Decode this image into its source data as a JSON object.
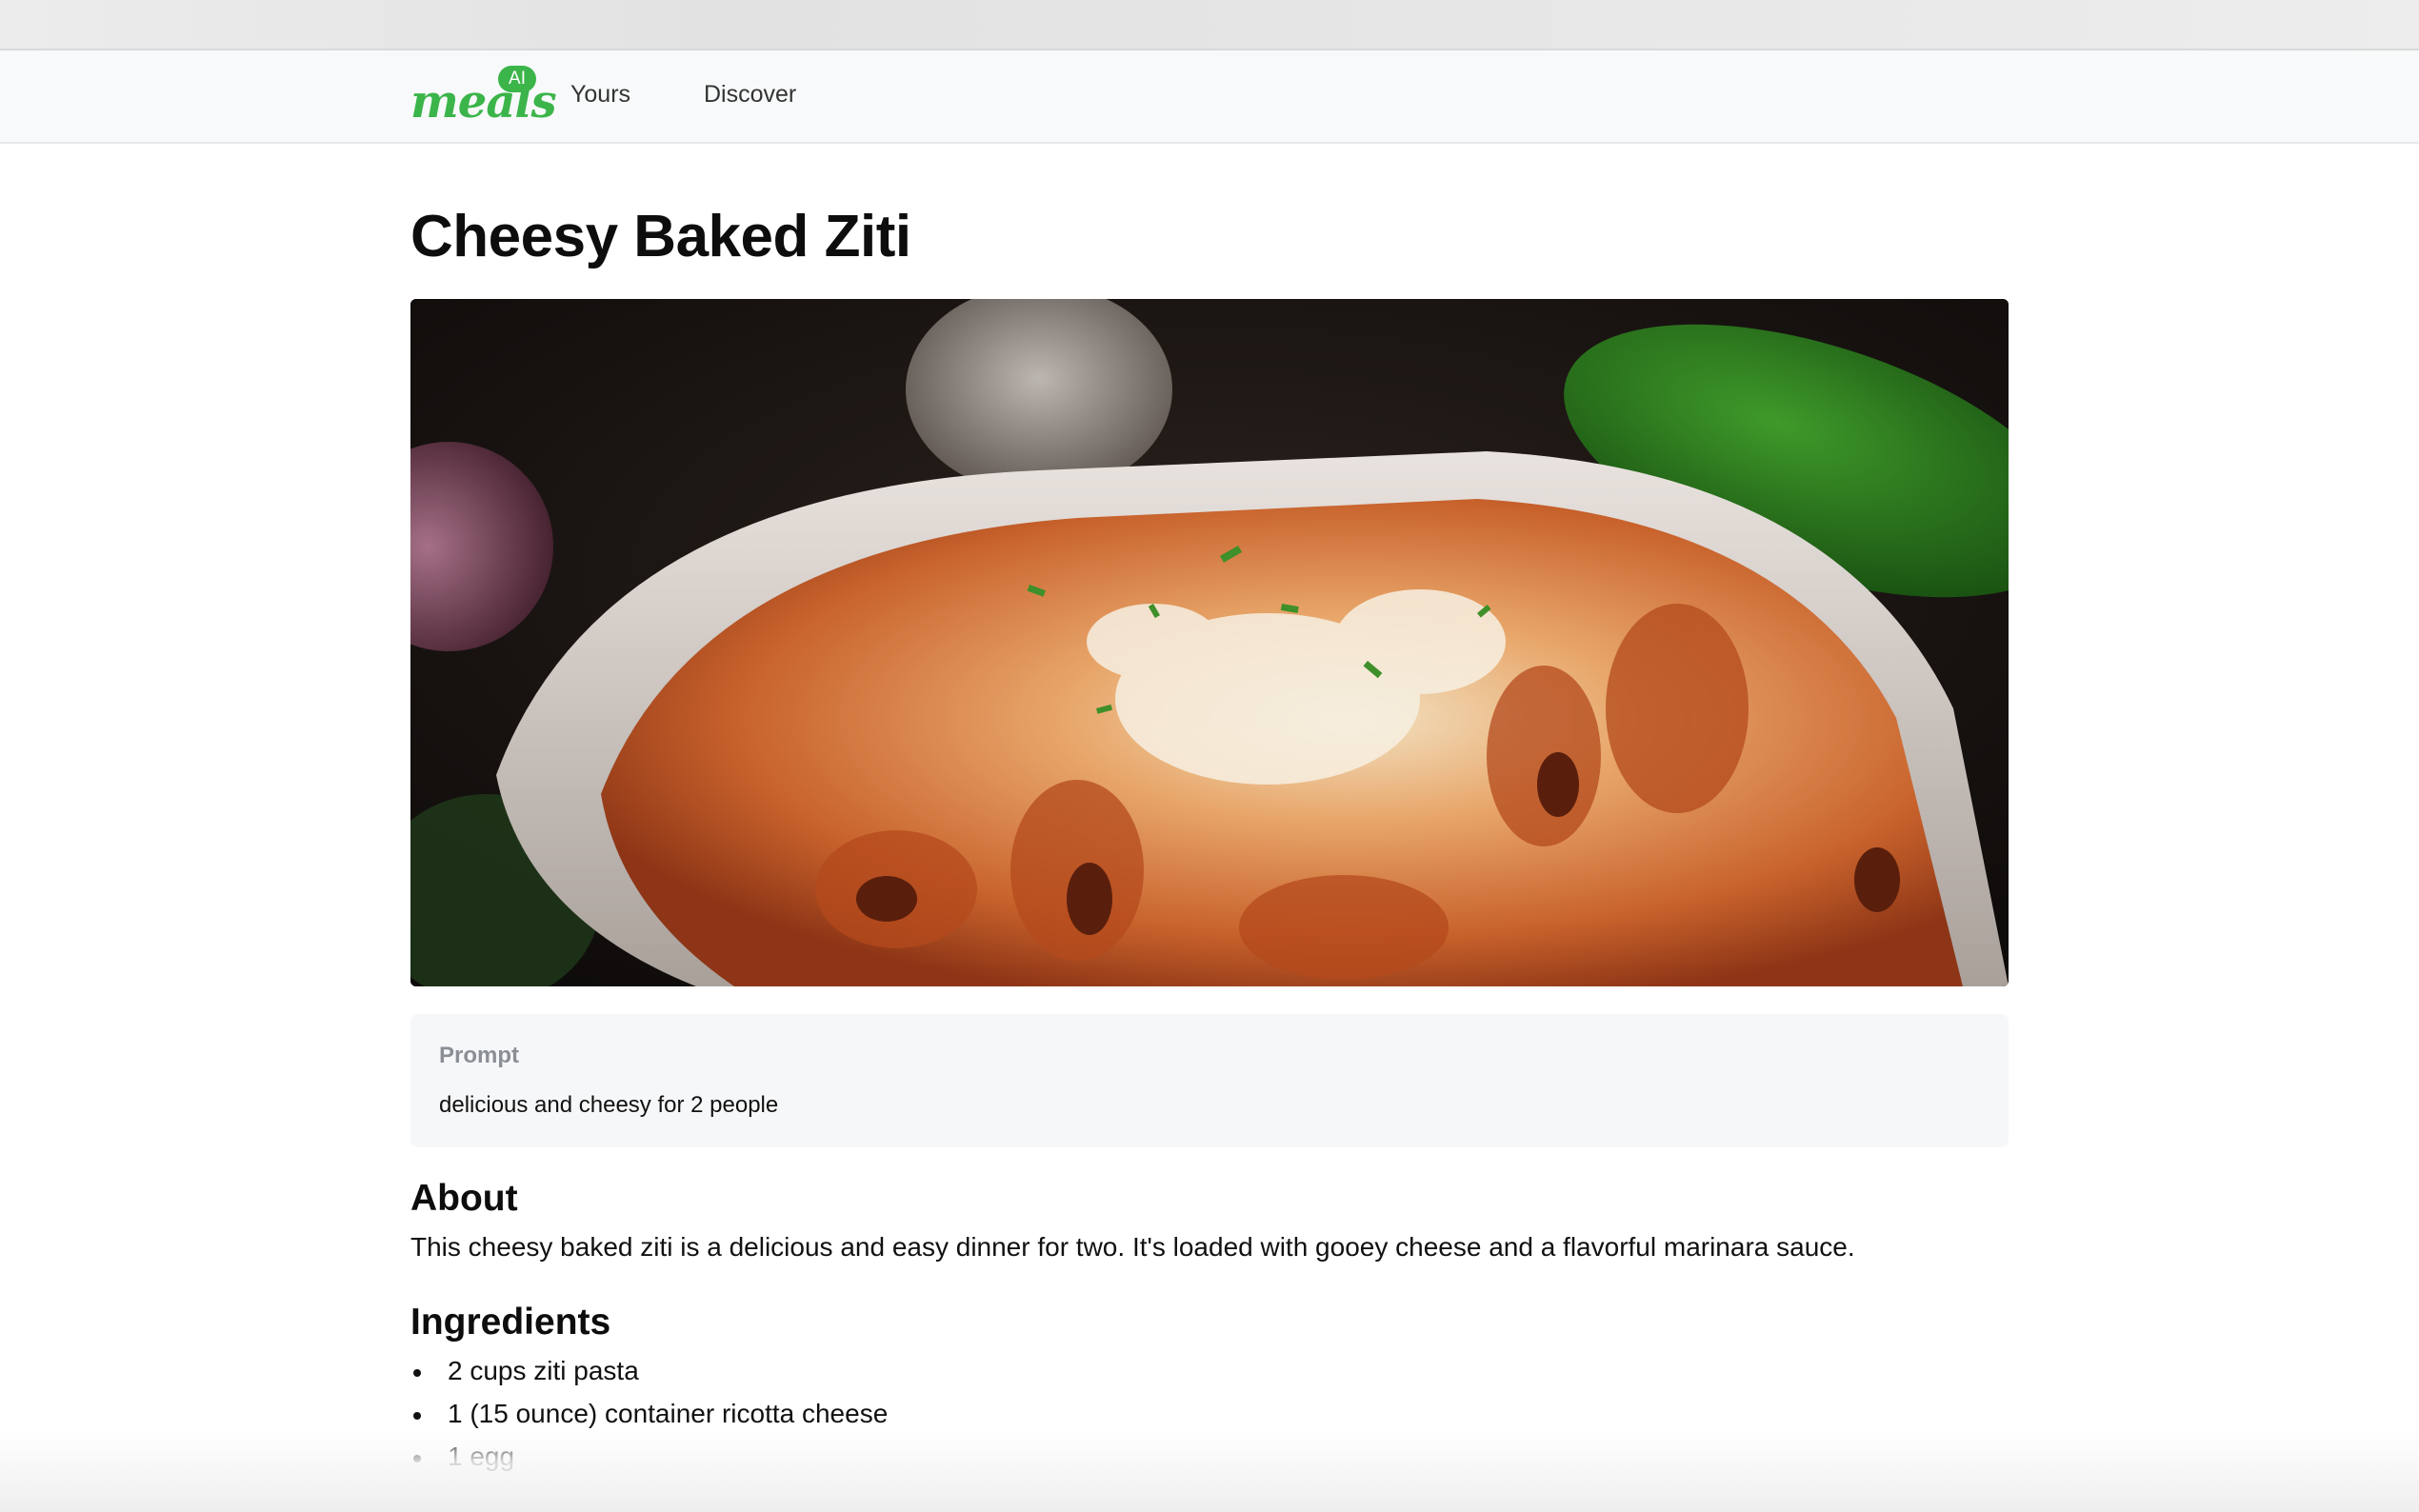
{
  "navbar": {
    "brand_text": "meals",
    "brand_badge": "AI",
    "links": [
      "Yours",
      "Discover"
    ]
  },
  "recipe": {
    "title": "Cheesy Baked Ziti",
    "prompt_label": "Prompt",
    "prompt_text": "delicious and cheesy for 2 people",
    "about_heading": "About",
    "about_text": "This cheesy baked ziti is a delicious and easy dinner for two. It's loaded with gooey cheese and a flavorful marinara sauce.",
    "ingredients_heading": "Ingredients",
    "ingredients": [
      "2 cups ziti pasta",
      "1 (15 ounce) container ricotta cheese",
      "1 egg"
    ]
  },
  "colors": {
    "brand_green": "#3bb54a",
    "navbar_bg": "#f8f9fa",
    "prompt_bg": "#f6f7f9"
  }
}
